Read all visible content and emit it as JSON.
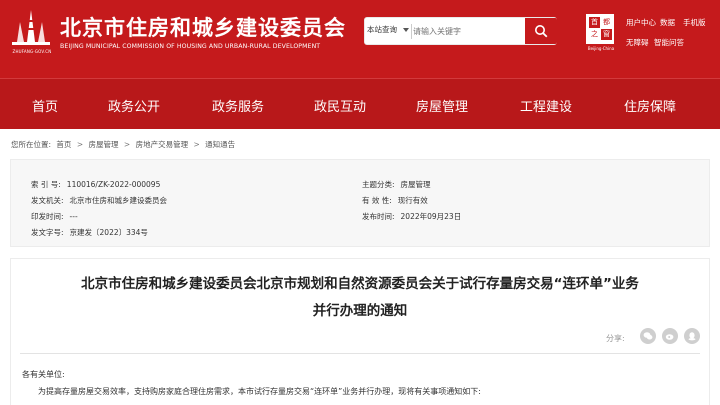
{
  "header": {
    "logo_caption": "ZHUFANG·GOV.CN",
    "title": "北京市住房和城乡建设委员会",
    "subtitle": "BEIJING MUNICIPAL COMMISSION OF HOUSING AND URBAN-RURAL DEVELOPMENT",
    "search_scope": "本站查询",
    "search_placeholder": "请输入关键字",
    "capital_logo": [
      "首",
      "都",
      "之",
      "窗"
    ],
    "capital_caption": "Beijing·China",
    "util_links": [
      "用户中心",
      "数据",
      "手机版",
      "无障碍",
      "智能问答"
    ]
  },
  "nav": {
    "items": [
      "首页",
      "政务公开",
      "政务服务",
      "政民互动",
      "房屋管理",
      "工程建设",
      "住房保障"
    ]
  },
  "breadcrumb": {
    "prefix": "您所在位置:",
    "items": [
      "首页",
      "房屋管理",
      "房地产交易管理",
      "通知通告"
    ]
  },
  "meta": {
    "index_no": {
      "label": "索 引 号:",
      "value": "110016/ZK-2022-000095"
    },
    "topic": {
      "label": "主题分类:",
      "value": "房屋管理"
    },
    "issuer": {
      "label": "发文机关:",
      "value": "北京市住房和城乡建设委员会"
    },
    "validity": {
      "label": "有 效 性:",
      "value": "现行有效"
    },
    "print_date": {
      "label": "印发时间:",
      "value": "---"
    },
    "publish_date": {
      "label": "发布时间:",
      "value": "2022年09月23日"
    },
    "doc_no": {
      "label": "发文字号:",
      "value": "京建发〔2022〕334号"
    }
  },
  "article": {
    "title_line1": "北京市住房和城乡建设委员会北京市规划和自然资源委员会关于试行存量房交易“连环单”业务",
    "title_line2": "并行办理的通知",
    "share_label": "分享:",
    "salutation": "各有关单位:",
    "para1": "为提高存量房屋交易效率，支持购房家庭合理住房需求，本市试行存量房交易“连环单”业务并行办理，现将有关事项通知如下:"
  }
}
